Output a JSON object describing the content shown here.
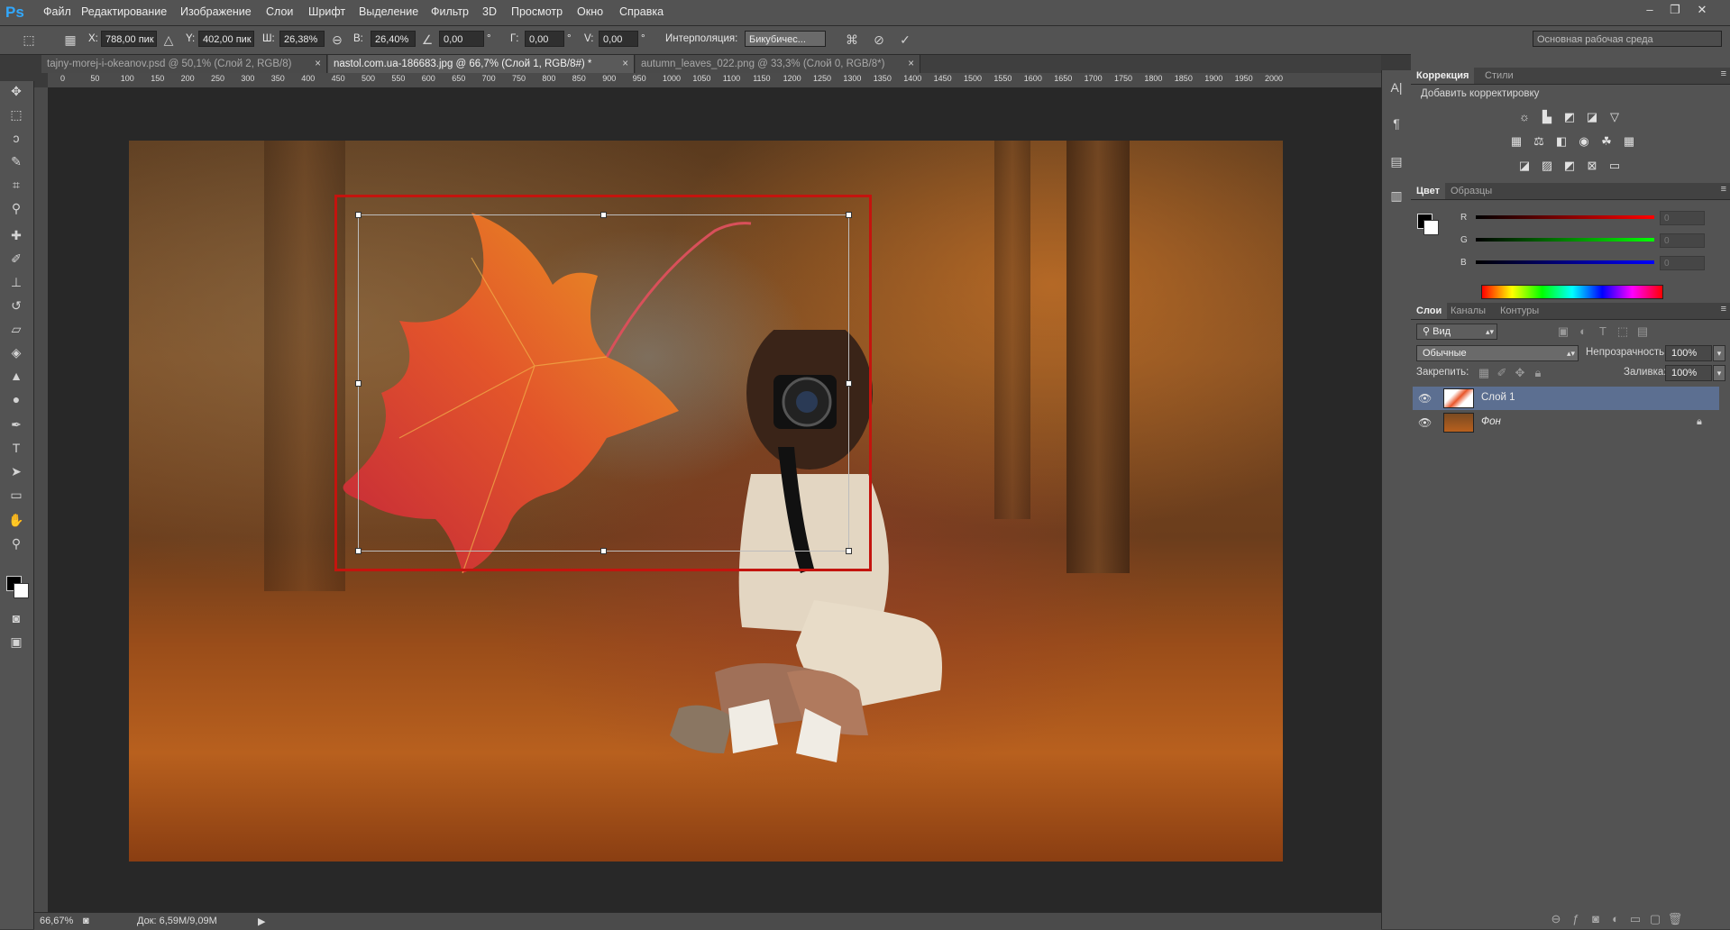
{
  "menubar": {
    "logo": "Ps",
    "items": [
      "Файл",
      "Редактирование",
      "Изображение",
      "Слои",
      "Шрифт",
      "Выделение",
      "Фильтр",
      "3D",
      "Просмотр",
      "Окно",
      "Справка"
    ],
    "window_controls": [
      "–",
      "❐",
      "✕"
    ]
  },
  "options": {
    "x_label": "X:",
    "x_value": "788,00 пик",
    "y_label": "Y:",
    "y_value": "402,00 пик",
    "w_label": "Ш:",
    "w_value": "26,38%",
    "h_label": "В:",
    "h_value": "26,40%",
    "angle_value": "0,00",
    "h_skew_label": "Г:",
    "h_skew_value": "0,00",
    "v_skew_label": "V:",
    "v_skew_value": "0,00",
    "degree_symbol": "°",
    "interp_label": "Интерполяция:",
    "interp_value": "Бикубичес...",
    "workspace": "Основная рабочая среда"
  },
  "tabs": [
    {
      "label": "tajny-morej-i-okeanov.psd @ 50,1% (Слой 2, RGB/8)",
      "active": false
    },
    {
      "label": "nastol.com.ua-186683.jpg @ 66,7% (Слой 1, RGB/8#) *",
      "active": true
    },
    {
      "label": "autumn_leaves_022.png @ 33,3% (Слой 0, RGB/8*)",
      "active": false
    }
  ],
  "ruler": {
    "top_ticks": [
      "0",
      "50",
      "100",
      "150",
      "200",
      "250",
      "300",
      "350",
      "400",
      "450",
      "500",
      "550",
      "600",
      "650",
      "700",
      "750",
      "800",
      "850",
      "900",
      "950",
      "1000",
      "1050",
      "1100",
      "1150",
      "1200",
      "1250",
      "1300",
      "1350",
      "1400",
      "1450",
      "1500",
      "1550",
      "1600",
      "1650",
      "1700",
      "1750",
      "1800",
      "1850",
      "1900",
      "1950",
      "2000"
    ]
  },
  "status": {
    "zoom": "66,67%",
    "doc": "Док: 6,59M/9,09M"
  },
  "panels": {
    "correction_tab": "Коррекция",
    "styles_tab": "Стили",
    "add_adjustment": "Добавить корректировку",
    "color_tab": "Цвет",
    "swatches_tab": "Образцы",
    "r_label": "R",
    "g_label": "G",
    "b_label": "B",
    "r_value": "0",
    "g_value": "0",
    "b_value": "0",
    "layers_tab": "Слои",
    "channels_tab": "Каналы",
    "paths_tab": "Контуры",
    "filter_value": "Вид",
    "blend_mode": "Обычные",
    "opacity_label": "Непрозрачность:",
    "opacity_value": "100%",
    "lock_label": "Закрепить:",
    "fill_label": "Заливка:",
    "fill_value": "100%",
    "layers": [
      {
        "name": "Слой 1",
        "selected": true
      },
      {
        "name": "Фон",
        "selected": false
      }
    ]
  },
  "colors": {
    "accent_selection": "#c4140e",
    "layer_highlight": "#5c6f91",
    "ps_blue": "#31a8ff"
  }
}
